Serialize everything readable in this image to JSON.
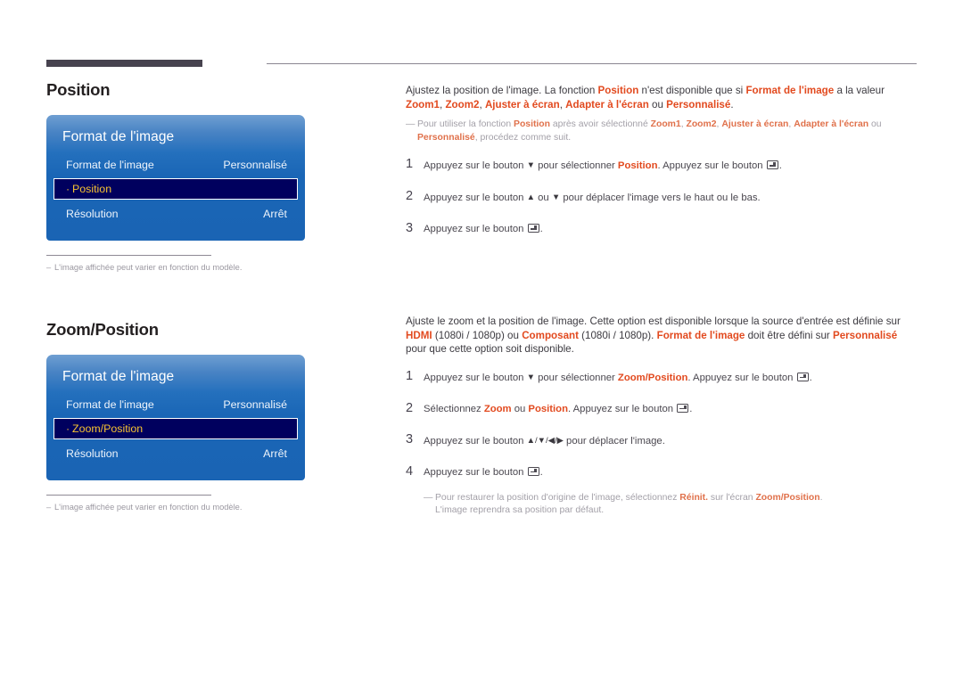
{
  "document": {
    "language": "fr"
  },
  "sections": [
    {
      "id": "position",
      "title": "Position",
      "osd": {
        "title": "Format de l'image",
        "rows": [
          {
            "label": "Format de l'image",
            "value": "Personnalisé",
            "selected": false
          },
          {
            "label": "Position",
            "value": "",
            "selected": true,
            "bullet": "·"
          },
          {
            "label": "Résolution",
            "value": "Arrêt",
            "selected": false
          }
        ]
      },
      "panel_note": {
        "dash": "–",
        "text": "L'image affichée peut varier en fonction du modèle."
      },
      "intro": {
        "line1_a": "Ajustez la position de l'image. La fonction ",
        "b1": "Position",
        "line1_b": " n'est disponible que si ",
        "b2": "Format de l'image",
        "line1_c": " a la valeur ",
        "b3": "Zoom1",
        "sep1": ", ",
        "b4": "Zoom2",
        "sep2": ", ",
        "b5": "Ajuster à écran",
        "sep3": ", ",
        "b6": "Adapter à l'écran",
        "line1_d": " ou ",
        "b7": "Personnalisé",
        "line1_e": "."
      },
      "note": {
        "dash": "—",
        "a": "Pour utiliser la fonction ",
        "b1": "Position",
        "b": " après avoir sélectionné ",
        "b2": "Zoom1",
        "s1": ", ",
        "b3": "Zoom2",
        "s2": ", ",
        "b4": "Ajuster à écran",
        "s3": ", ",
        "b5": "Adapter à l'écran",
        "c": " ou ",
        "b6": "Personnalisé",
        "d": ", procédez comme suit."
      },
      "steps": [
        {
          "num": "1",
          "a": "Appuyez sur le bouton ",
          "arrow1": "▼",
          "b": " pour sélectionner ",
          "hl": "Position",
          "c": ". Appuyez sur le bouton ",
          "d": "."
        },
        {
          "num": "2",
          "a": "Appuyez sur le bouton ",
          "arrow1": "▲",
          "b": " ou ",
          "arrow2": "▼",
          "c": " pour déplacer l'image vers le haut ou le bas."
        },
        {
          "num": "3",
          "a": "Appuyez sur le bouton ",
          "d": "."
        }
      ]
    },
    {
      "id": "zoom-position",
      "title": "Zoom/Position",
      "osd": {
        "title": "Format de l'image",
        "rows": [
          {
            "label": "Format de l'image",
            "value": "Personnalisé",
            "selected": false
          },
          {
            "label": "Zoom/Position",
            "value": "",
            "selected": true,
            "bullet": "·"
          },
          {
            "label": "Résolution",
            "value": "Arrêt",
            "selected": false
          }
        ]
      },
      "panel_note": {
        "dash": "–",
        "text": "L'image affichée peut varier en fonction du modèle."
      },
      "intro": {
        "a": "Ajuste le zoom et la position de l'image. Cette option est disponible lorsque la source d'entrée est définie sur ",
        "b1": "HDMI",
        "b": " (1080i / 1080p) ou ",
        "b2": "Composant",
        "c": " (1080i / 1080p). ",
        "b3": "Format de l'image",
        "d": " doit être défini sur ",
        "b4": "Personnalisé",
        "e": " pour que cette option soit disponible."
      },
      "steps": [
        {
          "num": "1",
          "a": "Appuyez sur le bouton ",
          "arrow1": "▼",
          "b": " pour sélectionner ",
          "hl": "Zoom/Position",
          "c": ". Appuyez sur le bouton ",
          "d": "."
        },
        {
          "num": "2",
          "a": "Sélectionnez ",
          "hl": "Zoom",
          "b": " ou ",
          "hl2": "Position",
          "c": ". Appuyez sur le bouton ",
          "d": "."
        },
        {
          "num": "3",
          "a": "Appuyez sur le bouton ",
          "arrows": "▲/▼/◀/▶",
          "c": " pour déplacer l'image."
        },
        {
          "num": "4",
          "a": "Appuyez sur le bouton ",
          "d": "."
        }
      ],
      "end_note": {
        "dash": "—",
        "a": "Pour restaurer la position d'origine de l'image, sélectionnez ",
        "b1": "Réinit.",
        "b": " sur l'écran ",
        "b2": "Zoom/Position",
        "c": ".",
        "line2": "L'image reprendra sa position par défaut."
      }
    }
  ],
  "colors": {
    "highlight_orange": "#e24a1f",
    "osd_blue_top": "#6f9fd2",
    "osd_blue_bottom": "#1a64b4",
    "osd_selected_bg": "#00005e",
    "osd_selected_text": "#f7c331",
    "rule_dark": "#47434f",
    "note_gray": "#a3a0a8"
  }
}
